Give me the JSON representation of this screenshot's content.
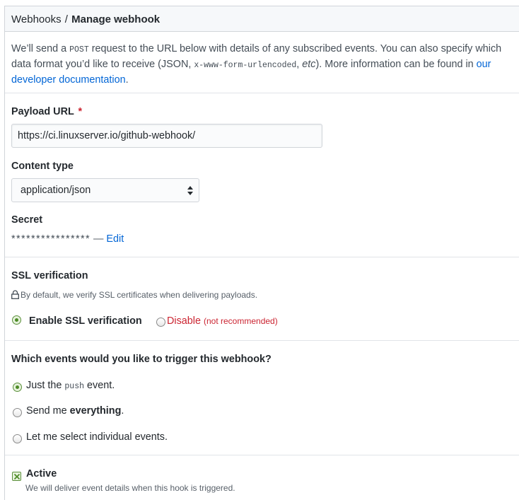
{
  "breadcrumb": {
    "parent": "Webhooks",
    "separator": "/",
    "current": "Manage webhook"
  },
  "intro": {
    "t1": "We’ll send a ",
    "method": "POST",
    "t2": " request to the URL below with details of any subscribed events. You can also specify which data format you’d like to receive (JSON, ",
    "encoding": "x-www-form-urlencoded",
    "t3": ", ",
    "etc": "etc",
    "t4": "). More information can be found in ",
    "link": "our developer documentation",
    "t5": "."
  },
  "payload_url": {
    "label": "Payload URL",
    "required_mark": "*",
    "value": "https://ci.linuxserver.io/github-webhook/"
  },
  "content_type": {
    "label": "Content type",
    "selected": "application/json"
  },
  "secret": {
    "label": "Secret",
    "masked": "****************",
    "dash": "—",
    "edit_link": "Edit"
  },
  "ssl": {
    "label": "SSL verification",
    "note": "By default, we verify SSL certificates when delivering payloads.",
    "enable_label": "Enable SSL verification",
    "disable_label": "Disable",
    "disable_note": "(not recommended)",
    "selected": "enable"
  },
  "events": {
    "question": "Which events would you like to trigger this webhook?",
    "opt1_a": "Just the ",
    "opt1_code": "push",
    "opt1_b": " event.",
    "opt2_a": "Send me ",
    "opt2_b": "everything",
    "opt2_c": ".",
    "opt3": "Let me select individual events.",
    "selected": "push"
  },
  "active": {
    "label": "Active",
    "checked": true,
    "hint": "We will deliver event details when this hook is triggered."
  }
}
